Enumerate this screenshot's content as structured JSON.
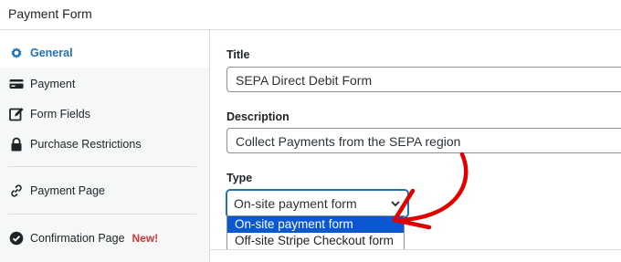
{
  "header": {
    "title": "Payment Form"
  },
  "sidebar": {
    "items": [
      {
        "label": "General",
        "icon": "gear-icon",
        "active": true
      },
      {
        "label": "Payment",
        "icon": "credit-card-icon"
      },
      {
        "label": "Form Fields",
        "icon": "edit-icon"
      },
      {
        "label": "Purchase Restrictions",
        "icon": "lock-icon"
      },
      {
        "label": "Payment Page",
        "icon": "link-icon"
      },
      {
        "label": "Confirmation Page",
        "icon": "check-circle-icon",
        "badge": "New!"
      }
    ]
  },
  "main": {
    "title_label": "Title",
    "title_value": "SEPA Direct Debit Form",
    "description_label": "Description",
    "description_value": "Collect Payments from the SEPA region",
    "type_label": "Type",
    "type_selected": "On-site payment form",
    "type_options": [
      "On-site payment form",
      "Off-site Stripe Checkout form"
    ]
  },
  "colors": {
    "accent": "#2271b1",
    "badge": "#d63638",
    "annotation_arrow": "#e00000",
    "option_highlight": "#0b57d0"
  }
}
